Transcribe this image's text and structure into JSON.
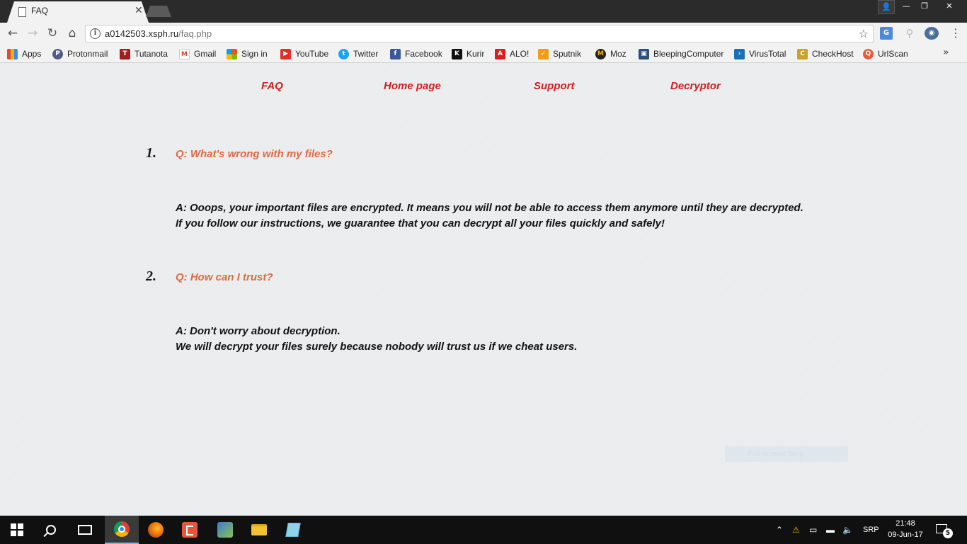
{
  "browser": {
    "tab_title": "FAQ",
    "url_host": "a0142503.xsph.ru",
    "url_path": "/faq.php",
    "bookmarks": [
      {
        "label": "Apps",
        "icon": "apps-grid-icon",
        "color": "#e04a3a"
      },
      {
        "label": "Protonmail",
        "icon": "protonmail-icon",
        "color": "#505a8a"
      },
      {
        "label": "Tutanota",
        "icon": "tutanota-icon",
        "color": "#a01e1e"
      },
      {
        "label": "Gmail",
        "icon": "gmail-icon",
        "color": "#d44638"
      },
      {
        "label": "Sign in",
        "icon": "microsoft-icon",
        "color": "#3a8ee6"
      },
      {
        "label": "YouTube",
        "icon": "youtube-icon",
        "color": "#e52d27"
      },
      {
        "label": "Twitter",
        "icon": "twitter-icon",
        "color": "#1da1f2"
      },
      {
        "label": "Facebook",
        "icon": "facebook-icon",
        "color": "#3b5998"
      },
      {
        "label": "Kurir",
        "icon": "kurir-icon",
        "color": "#111111"
      },
      {
        "label": "ALO!",
        "icon": "alo-icon",
        "color": "#d91e1e"
      },
      {
        "label": "Sputnik",
        "icon": "sputnik-icon",
        "color": "#f39c12"
      },
      {
        "label": "Moz",
        "icon": "moz-icon",
        "color": "#222222"
      },
      {
        "label": "BleepingComputer",
        "icon": "bleepingcomputer-icon",
        "color": "#2c4f7c"
      },
      {
        "label": "VirusTotal",
        "icon": "virustotal-icon",
        "color": "#1c6fb6"
      },
      {
        "label": "CheckHost",
        "icon": "checkhost-icon",
        "color": "#c9a227"
      },
      {
        "label": "UrlScan",
        "icon": "urlscan-icon",
        "color": "#e25c3c"
      }
    ]
  },
  "nav": {
    "faq": "FAQ",
    "home": "Home page",
    "support": "Support",
    "decryptor": "Decryptor"
  },
  "faq": [
    {
      "number": "1.",
      "question": "Q: What's wrong with my files?",
      "answer_line1": "A: Ooops, your important files are encrypted. It means you will not be able to access them anymore until they are decrypted.",
      "answer_line2": "If you follow our instructions, we guarantee that you can decrypt all your files quickly and safely!"
    },
    {
      "number": "2.",
      "question": "Q: How can I trust?",
      "answer_line1": "A: Don't worry about decryption.",
      "answer_line2": "We will decrypt your files surely because nobody will trust us if we cheat users."
    }
  ],
  "overlay": {
    "snip_label": "Full-screen Snip"
  },
  "taskbar": {
    "language": "SRP",
    "time": "21:48",
    "date": "09-Jun-17",
    "notification_count": "5"
  },
  "colors": {
    "nav_link": "#d11e1e",
    "question": "#e06a40",
    "answer": "#121212"
  }
}
